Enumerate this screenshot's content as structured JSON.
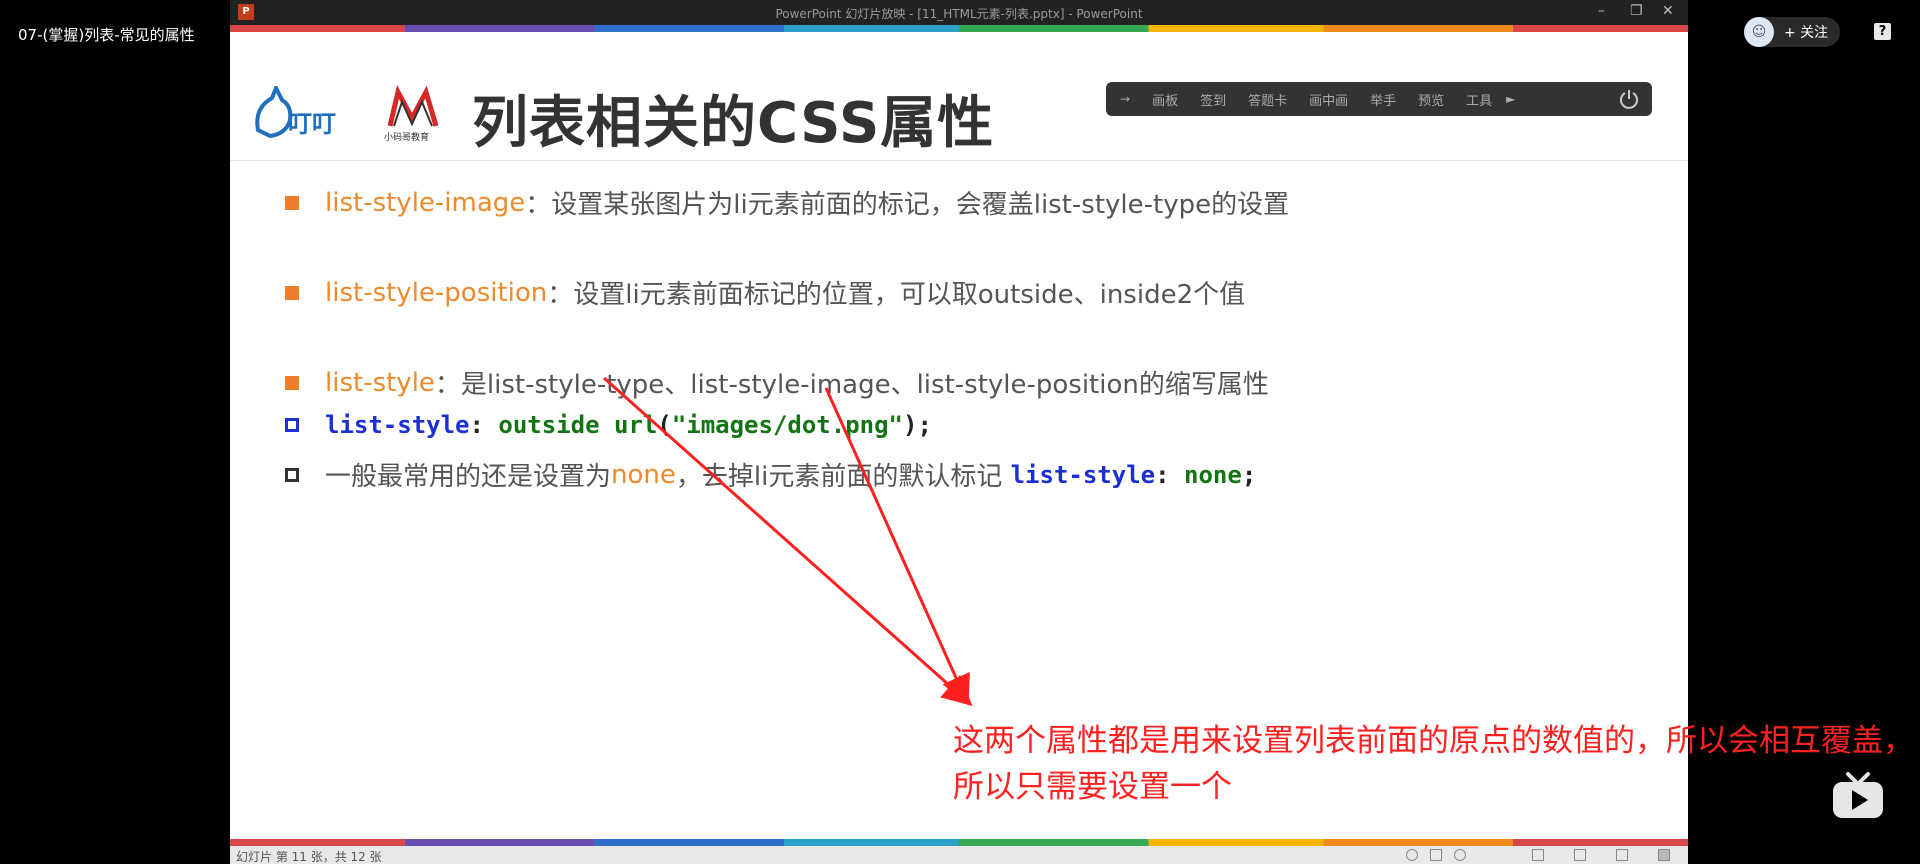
{
  "player": {
    "video_title": "07-(掌握)列表-常见的属性",
    "follow_label": "+ 关注",
    "help_label": "?"
  },
  "window": {
    "title": "PowerPoint 幻灯片放映 - [11_HTML元素-列表.pptx] - PowerPoint",
    "app_icon": "P",
    "minimize": "–",
    "restore": "❐",
    "close": "✕"
  },
  "slide": {
    "title": "列表相关的CSS属性",
    "logo_text": "小码哥教育",
    "toolbar": [
      "画板",
      "签到",
      "答题卡",
      "画中画",
      "举手",
      "预览",
      "工具"
    ],
    "bullets": [
      {
        "keyword": "list-style-image",
        "text": "：设置某张图片为li元素前面的标记，会覆盖list-style-type的设置"
      },
      {
        "keyword": "list-style-position",
        "text": "：设置li元素前面标记的位置，可以取outside、inside2个值"
      },
      {
        "keyword": "list-style",
        "text": "：是list-style-type、list-style-image、list-style-position的缩写属性"
      }
    ],
    "code_line": {
      "prop": "list-style",
      "colon": ": ",
      "val": "outside url",
      "paren_open": "(",
      "str": "\"images/dot.png\"",
      "paren_close": ");"
    },
    "tip_line": {
      "prefix": "一般最常用的还是设置为",
      "highlight": "none",
      "middle": "，去掉li元素前面的默认标记 ",
      "prop": "list-style",
      "colon": ": ",
      "val": "none",
      "end": ";"
    }
  },
  "annotation": {
    "note": "这两个属性都是用来设置列表前面的原点的数值的，所以会相互覆盖，所以只需要设置一个",
    "color": "#ff2020"
  },
  "statusbar": {
    "slide_num": "幻灯片 第 11 张，共 12 张"
  },
  "colors": {
    "keyword": "#ee8a2c",
    "css_property": "#1c2fd0",
    "css_value": "#137413"
  }
}
